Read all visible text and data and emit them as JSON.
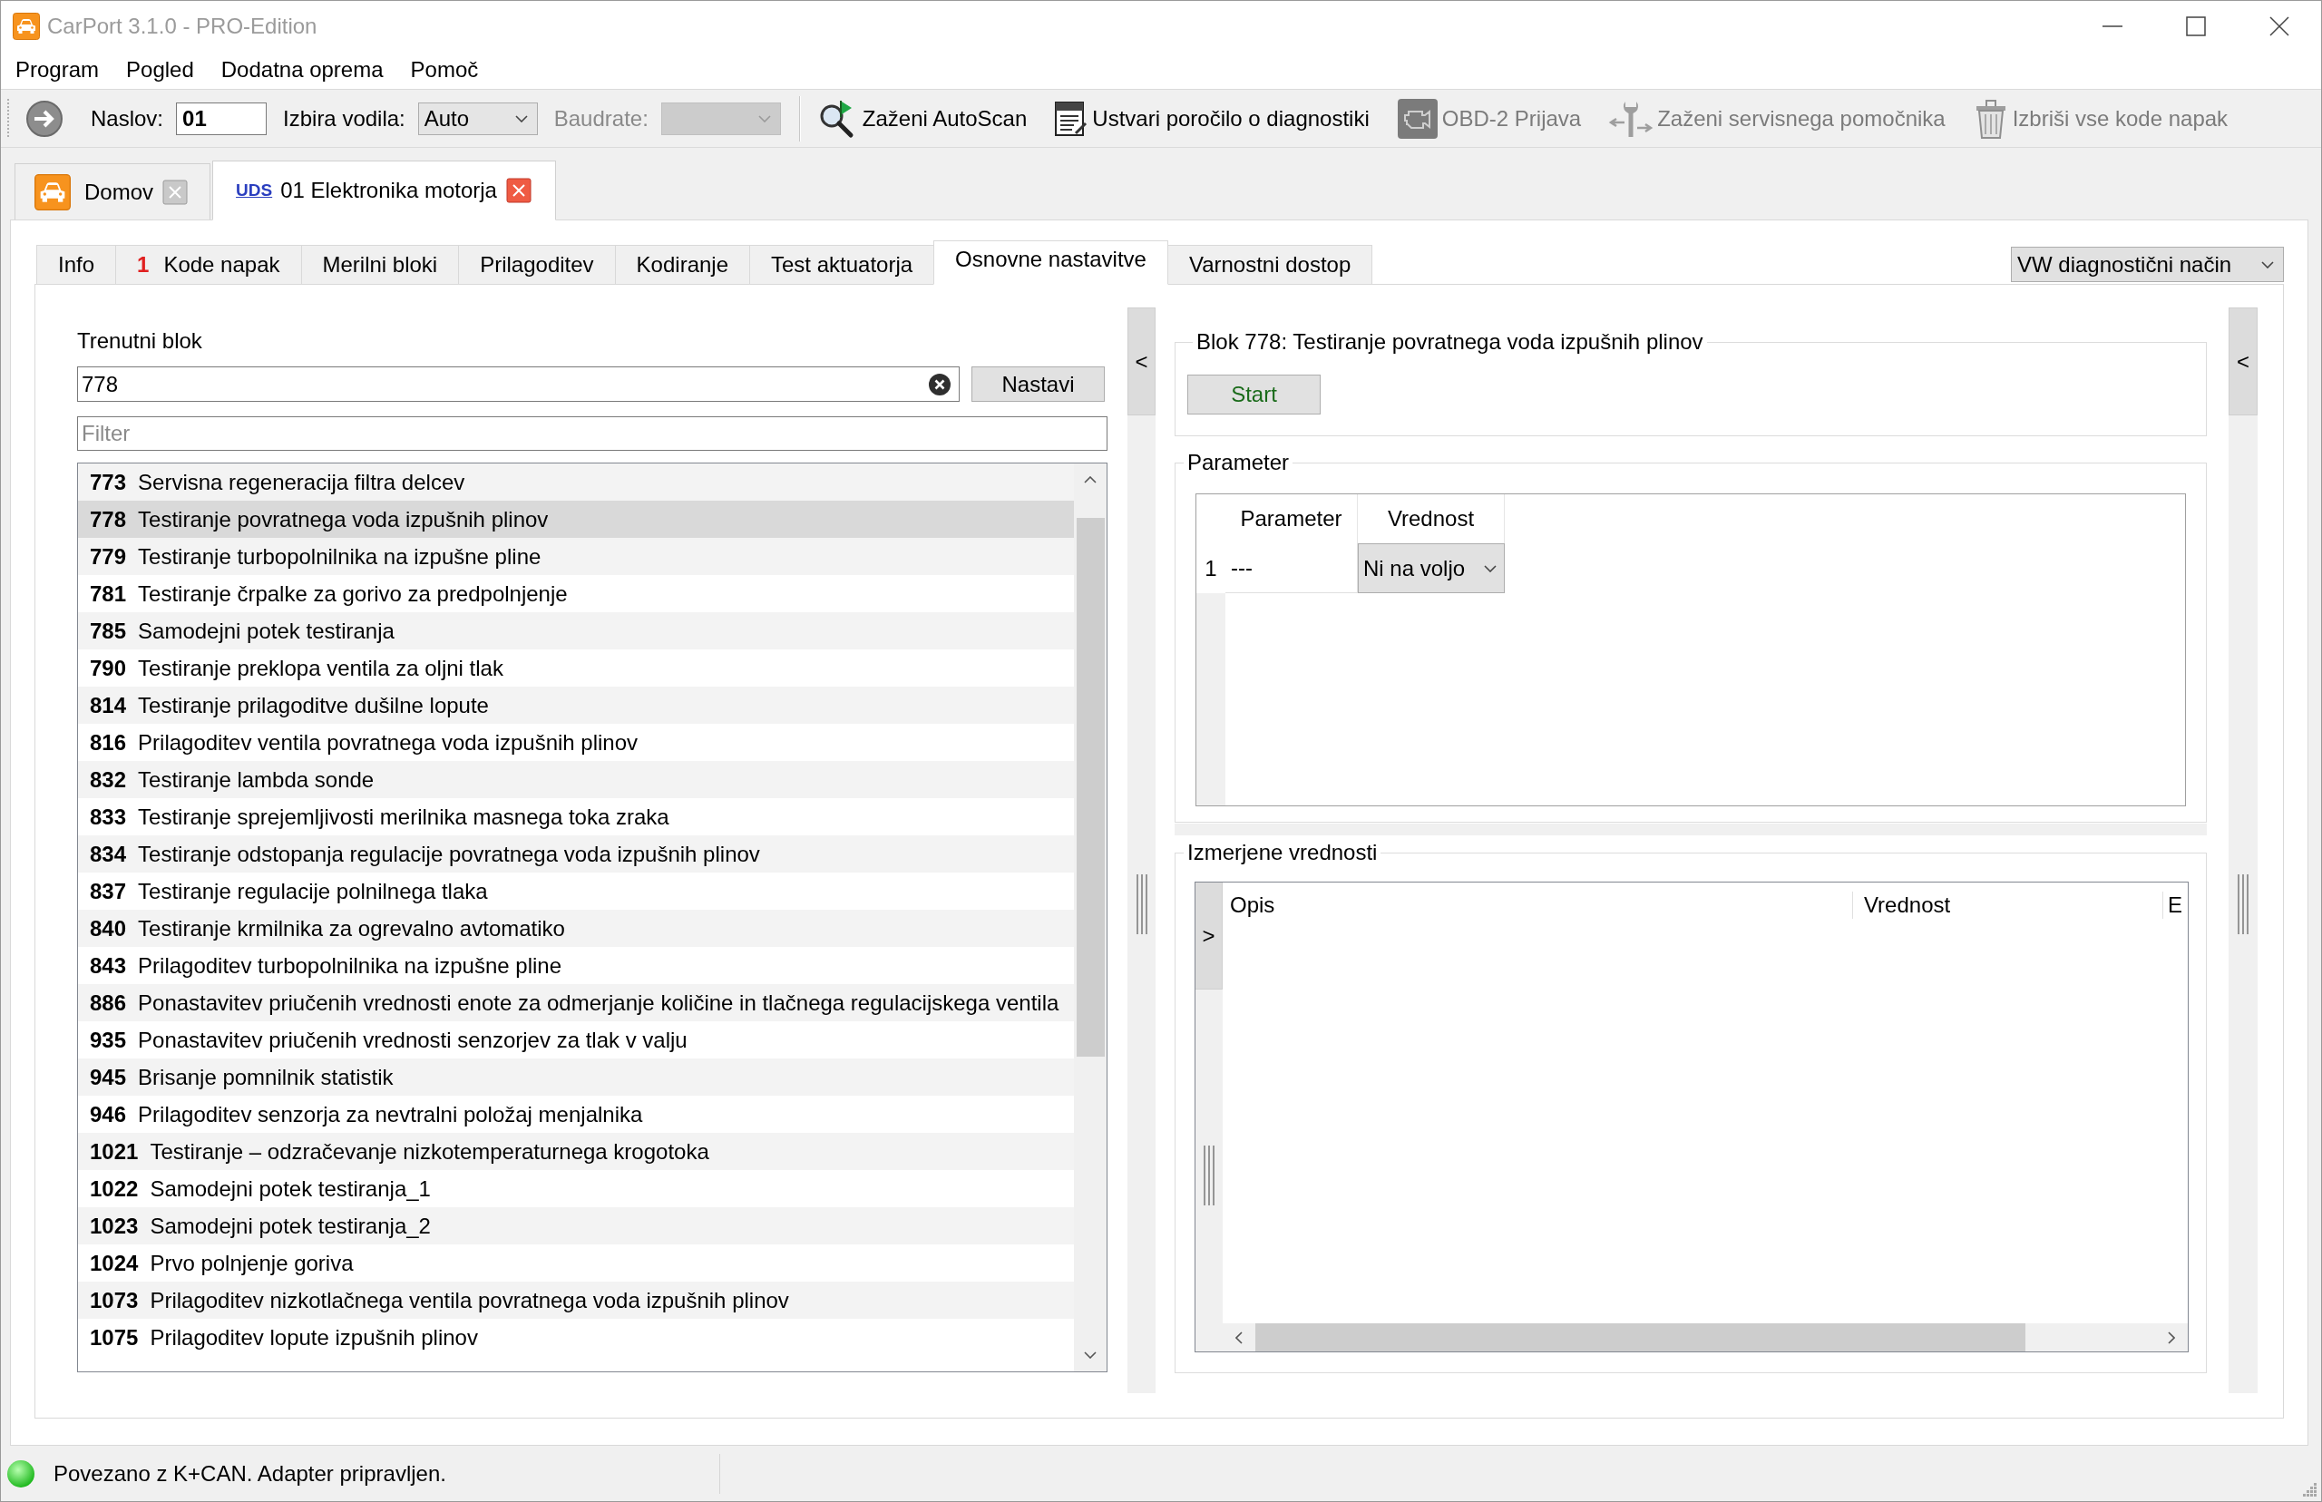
{
  "window": {
    "title": "CarPort 3.1.0 - PRO-Edition"
  },
  "menu": [
    "Program",
    "Pogled",
    "Dodatna oprema",
    "Pomoč"
  ],
  "toolbar": {
    "fields": [
      {
        "kind": "input",
        "label": "Naslov:",
        "value": "01",
        "disabled": false
      },
      {
        "kind": "select",
        "label": "Izbira vodila:",
        "value": "Auto",
        "disabled": false
      },
      {
        "kind": "select",
        "label": "Baudrate:",
        "disabled": true
      }
    ],
    "actions": [
      {
        "label": "Zaženi AutoScan",
        "disabled": false
      },
      {
        "label": "Ustvari poročilo o diagnostiki",
        "disabled": false
      },
      {
        "label": "OBD-2 Prijava",
        "disabled": true
      },
      {
        "label": "Zaženi servisnega pomočnika",
        "disabled": true
      },
      {
        "label": "Izbriši vse kode napak",
        "disabled": true
      }
    ]
  },
  "document_tabs": [
    {
      "label": "Domov",
      "selected": false
    },
    {
      "protocol": "UDS",
      "label": "01 Elektronika motorja",
      "selected": true
    }
  ],
  "function_tabs": [
    {
      "label": "Info",
      "selected": false
    },
    {
      "count": "1",
      "label": "Kode napak",
      "selected": false
    },
    {
      "label": "Merilni bloki",
      "selected": false
    },
    {
      "label": "Prilagoditev",
      "selected": false
    },
    {
      "label": "Kodiranje",
      "selected": false
    },
    {
      "label": "Test aktuatorja",
      "selected": false
    },
    {
      "label": "Osnovne nastavitve",
      "selected": true
    },
    {
      "label": "Varnostni dostop",
      "selected": false
    }
  ],
  "mode_select": {
    "value": "VW diagnostični način"
  },
  "block_selector": {
    "label": "Trenutni blok",
    "value": "778",
    "apply_button": "Nastavi",
    "filter_placeholder": "Filter",
    "blocks": [
      {
        "number": "773",
        "name": "Servisna regeneracija filtra delcev",
        "selected": false
      },
      {
        "number": "778",
        "name": "Testiranje povratnega voda izpušnih plinov",
        "selected": true
      },
      {
        "number": "779",
        "name": "Testiranje turbopolnilnika na izpušne pline",
        "selected": false
      },
      {
        "number": "781",
        "name": "Testiranje črpalke za gorivo za predpolnjenje",
        "selected": false
      },
      {
        "number": "785",
        "name": "Samodejni potek testiranja",
        "selected": false
      },
      {
        "number": "790",
        "name": "Testiranje preklopa ventila za oljni tlak",
        "selected": false
      },
      {
        "number": "814",
        "name": "Testiranje prilagoditve dušilne lopute",
        "selected": false
      },
      {
        "number": "816",
        "name": "Prilagoditev ventila povratnega voda izpušnih plinov",
        "selected": false
      },
      {
        "number": "832",
        "name": "Testiranje lambda sonde",
        "selected": false
      },
      {
        "number": "833",
        "name": "Testiranje sprejemljivosti merilnika masnega toka zraka",
        "selected": false
      },
      {
        "number": "834",
        "name": "Testiranje odstopanja regulacije povratnega voda izpušnih plinov",
        "selected": false
      },
      {
        "number": "837",
        "name": "Testiranje regulacije polnilnega tlaka",
        "selected": false
      },
      {
        "number": "840",
        "name": "Testiranje krmilnika za ogrevalno avtomatiko",
        "selected": false
      },
      {
        "number": "843",
        "name": "Prilagoditev turbopolnilnika na izpušne pline",
        "selected": false
      },
      {
        "number": "886",
        "name": "Ponastavitev priučenih vrednosti enote za odmerjanje količine in tlačnega regulacijskega ventila",
        "selected": false
      },
      {
        "number": "935",
        "name": "Ponastavitev priučenih vrednosti senzorjev za tlak v valju",
        "selected": false
      },
      {
        "number": "945",
        "name": "Brisanje pomnilnik statistik",
        "selected": false
      },
      {
        "number": "946",
        "name": "Prilagoditev senzorja za nevtralni položaj menjalnika",
        "selected": false
      },
      {
        "number": "1021",
        "name": "Testiranje – odzračevanje nizkotemperaturnega krogotoka",
        "selected": false
      },
      {
        "number": "1022",
        "name": "Samodejni potek testiranja_1",
        "selected": false
      },
      {
        "number": "1023",
        "name": "Samodejni potek testiranja_2",
        "selected": false
      },
      {
        "number": "1024",
        "name": "Prvo polnjenje goriva",
        "selected": false
      },
      {
        "number": "1073",
        "name": "Prilagoditev nizkotlačnega ventila povratnega voda izpušnih plinov",
        "selected": false
      },
      {
        "number": "1075",
        "name": "Prilagoditev lopute izpušnih plinov",
        "selected": false
      }
    ]
  },
  "left_splitter": {
    "button": "<"
  },
  "block_group": {
    "title": "Blok 778: Testiranje povratnega voda izpušnih plinov",
    "start_button": "Start"
  },
  "parameter_group": {
    "title": "Parameter",
    "columns": [
      "Parameter",
      "Vrednost"
    ],
    "rows": [
      {
        "index": "1",
        "parameter": "---",
        "value": "Ni na voljo"
      }
    ]
  },
  "measured_group": {
    "title": "Izmerjene vrednosti",
    "expand_button": ">",
    "columns": [
      "Opis",
      "Vrednost",
      "E"
    ]
  },
  "right_splitter": {
    "button": "<"
  },
  "status_bar": {
    "connected": true,
    "text": "Povezano z K+CAN. Adapter pripravljen."
  }
}
